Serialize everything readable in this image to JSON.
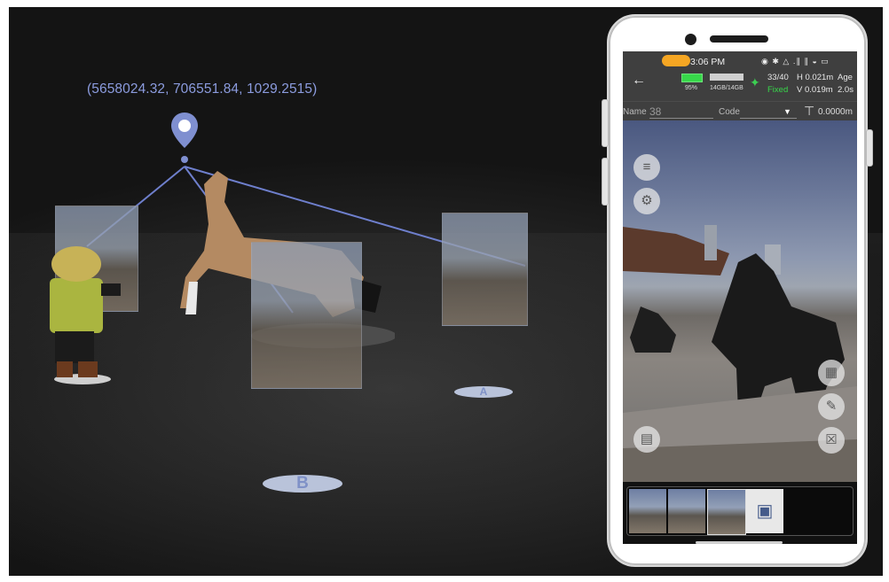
{
  "scene": {
    "coordinates_label": "(5658024.32, 706551.84, 1029.2515)",
    "markers": [
      {
        "label": "A"
      },
      {
        "label": "B"
      }
    ],
    "colors": {
      "accent": "#8c9cdf",
      "pin": "#7f8fd0"
    }
  },
  "phone": {
    "status": {
      "time": "3:06 PM",
      "sys_icons": "◉ ✱ △ .∥ ∥ ◒ ▭"
    },
    "header": {
      "back_icon": "←",
      "battery": "95%",
      "storage": "14GB/14GB",
      "satellites": "33/40",
      "fix_status": "Fixed",
      "h_accuracy": "H 0.021m",
      "v_accuracy": "V 0.019m",
      "age_label": "Age",
      "age_value": "2.0s"
    },
    "fields": {
      "name_label": "Name",
      "name_value": "38",
      "code_label": "Code",
      "code_arrow": "▼",
      "height_icon": "⊤",
      "height_value": "0.0000m"
    },
    "tools": {
      "layers_icon": "≡",
      "settings_icon": "⚙",
      "map_icon": "▤",
      "calculator_icon": "▦",
      "edit_icon": "✎",
      "delete_icon": "☒"
    },
    "thumbnails": {
      "camera_icon": "▣"
    }
  }
}
